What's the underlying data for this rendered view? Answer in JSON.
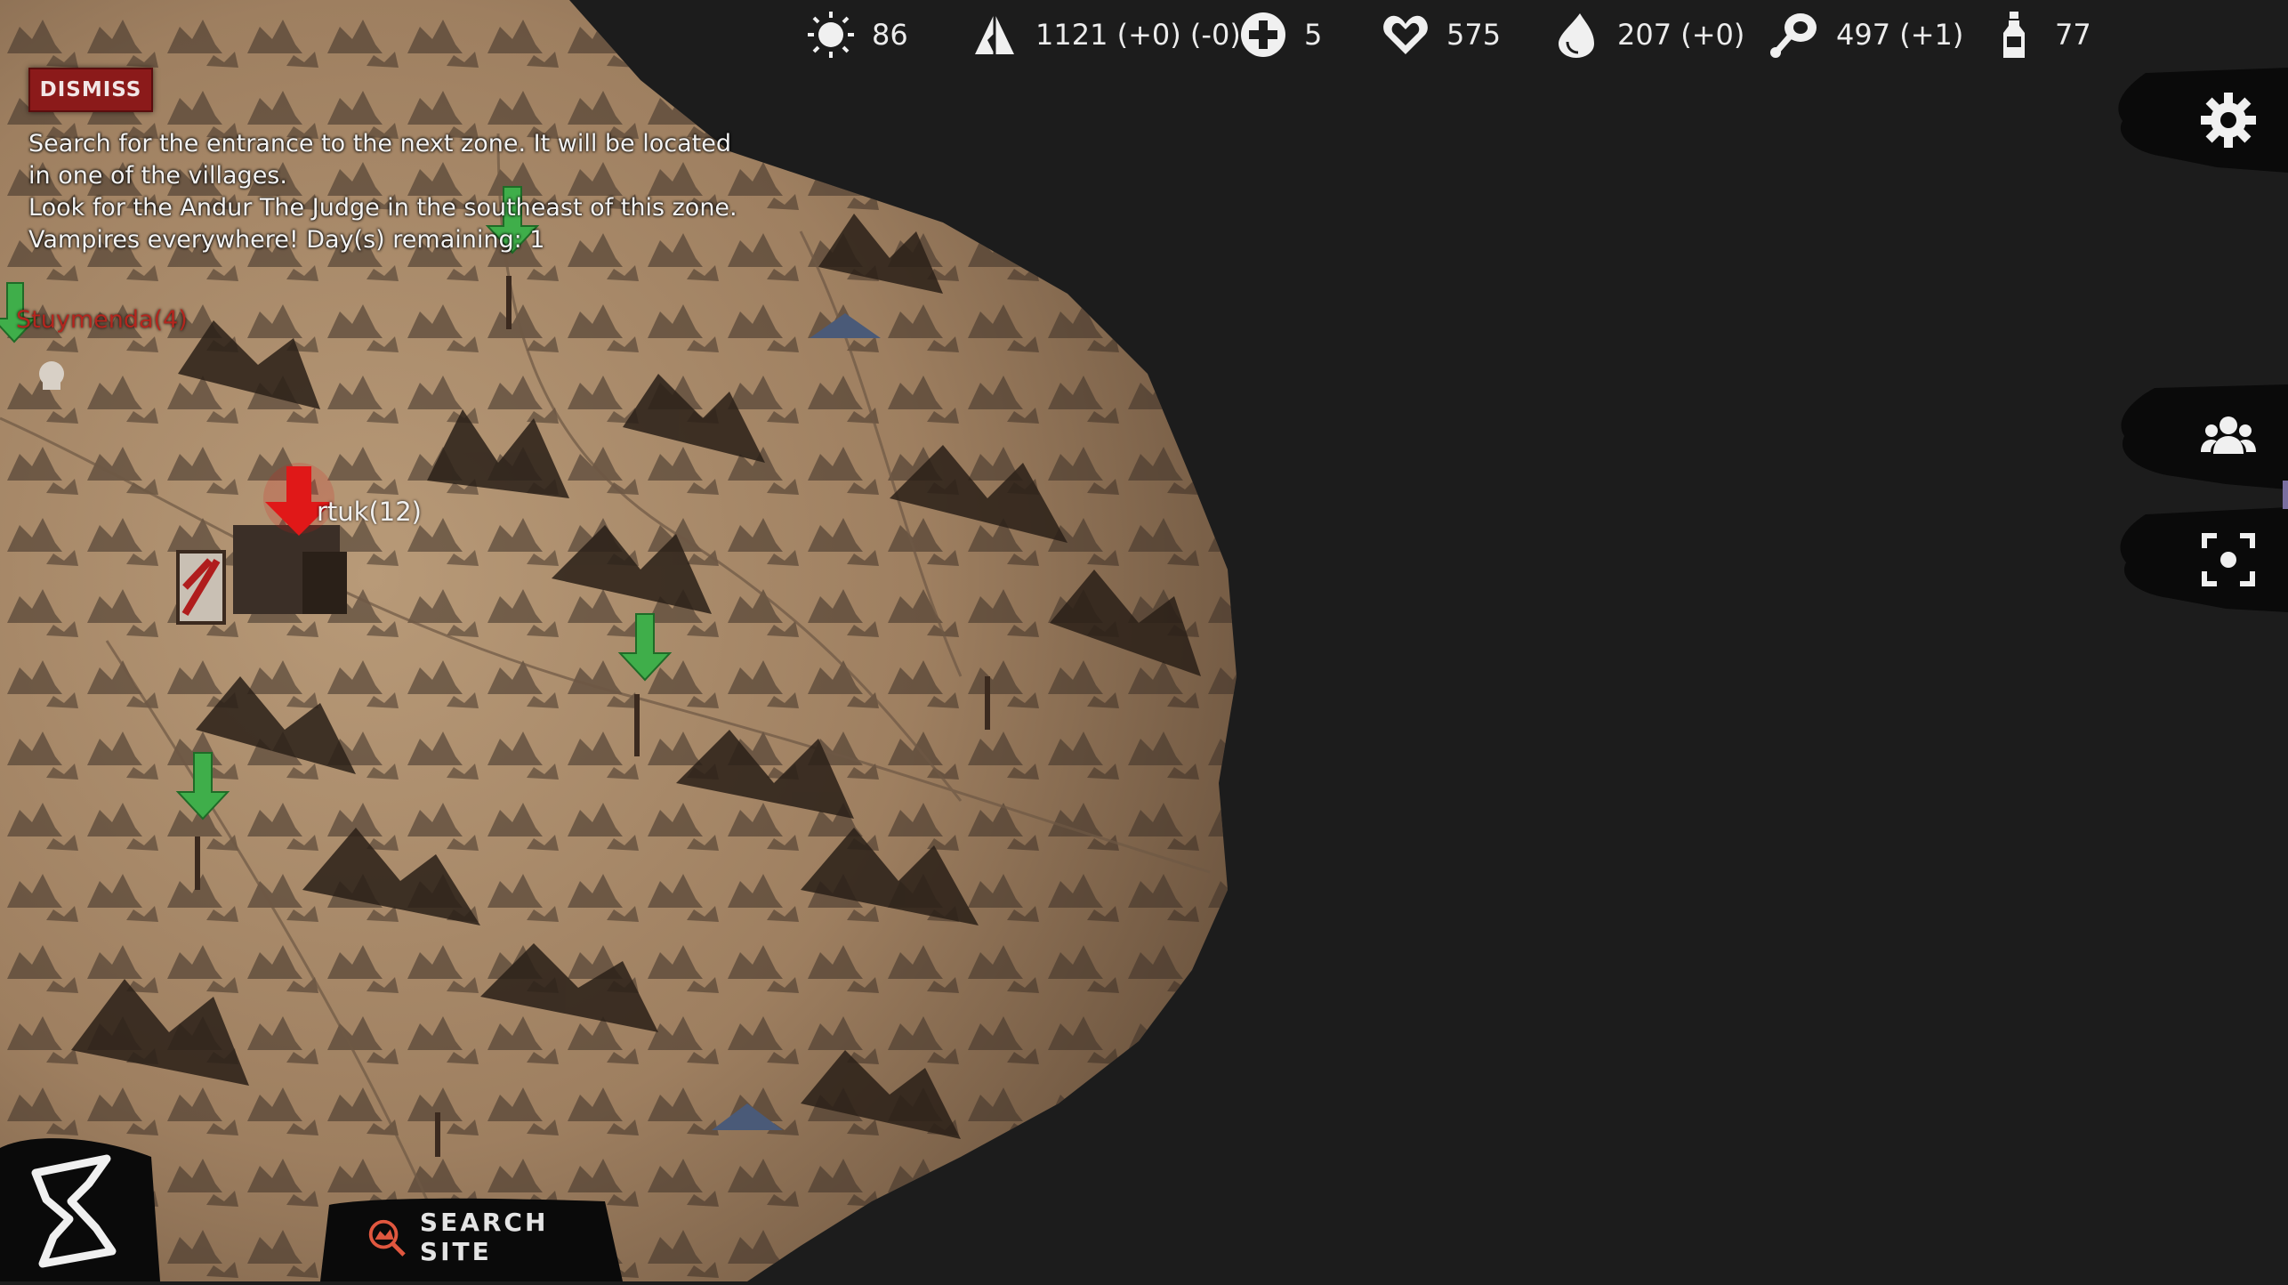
{
  "resources": [
    {
      "icon": "sun-icon",
      "value": "86"
    },
    {
      "icon": "tent-icon",
      "value": "1121 (+0) (-0)"
    },
    {
      "icon": "medical-cross-icon",
      "value": "5"
    },
    {
      "icon": "heart-icon",
      "value": "575"
    },
    {
      "icon": "blood-drop-icon",
      "value": "207 (+0)"
    },
    {
      "icon": "meat-icon",
      "value": "497 (+1)"
    },
    {
      "icon": "bottle-icon",
      "value": "77"
    }
  ],
  "quest": {
    "dismiss_label": "DISMISS",
    "lines": [
      "Search for the entrance to the next zone. It will be located",
      "in one of the villages.",
      "Look for the Andur The Judge in the southeast of this zone.",
      "Vampires everywhere! Day(s) remaining: 1"
    ]
  },
  "map": {
    "location_label": "rtuk(12)",
    "enemy_label": "Stuymenda(4)"
  },
  "actions": {
    "search_site_label": "SEARCH SITE"
  },
  "colors": {
    "sand": "#a8896a",
    "dark_bg": "#1c1c1c",
    "dismiss_red": "#8b1a1a",
    "marker_green": "#3fae4a",
    "marker_red": "#e01818"
  }
}
